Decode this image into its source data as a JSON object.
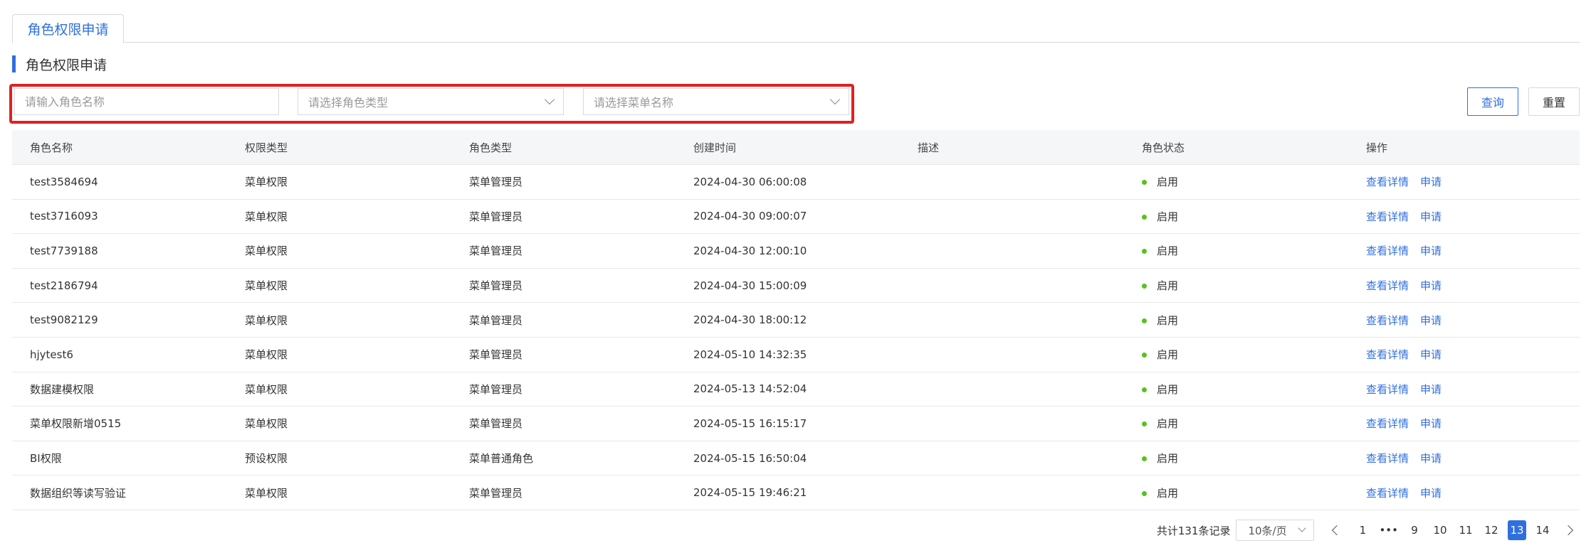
{
  "tabs": [
    {
      "label": "角色权限申请"
    }
  ],
  "section": {
    "title": "角色权限申请"
  },
  "filters": {
    "role_name_placeholder": "请输入角色名称",
    "role_type_placeholder": "请选择角色类型",
    "menu_name_placeholder": "请选择菜单名称"
  },
  "buttons": {
    "query": "查询",
    "reset": "重置"
  },
  "table": {
    "headers": [
      "角色名称",
      "权限类型",
      "角色类型",
      "创建时间",
      "描述",
      "角色状态",
      "操作"
    ],
    "rows": [
      {
        "name": "test3584694",
        "perm_type": "菜单权限",
        "role_type": "菜单管理员",
        "created": "2024-04-30 06:00:08",
        "desc": "",
        "status": "启用",
        "view": "查看详情",
        "apply": "申请"
      },
      {
        "name": "test3716093",
        "perm_type": "菜单权限",
        "role_type": "菜单管理员",
        "created": "2024-04-30 09:00:07",
        "desc": "",
        "status": "启用",
        "view": "查看详情",
        "apply": "申请"
      },
      {
        "name": "test7739188",
        "perm_type": "菜单权限",
        "role_type": "菜单管理员",
        "created": "2024-04-30 12:00:10",
        "desc": "",
        "status": "启用",
        "view": "查看详情",
        "apply": "申请"
      },
      {
        "name": "test2186794",
        "perm_type": "菜单权限",
        "role_type": "菜单管理员",
        "created": "2024-04-30 15:00:09",
        "desc": "",
        "status": "启用",
        "view": "查看详情",
        "apply": "申请"
      },
      {
        "name": "test9082129",
        "perm_type": "菜单权限",
        "role_type": "菜单管理员",
        "created": "2024-04-30 18:00:12",
        "desc": "",
        "status": "启用",
        "view": "查看详情",
        "apply": "申请"
      },
      {
        "name": "hjytest6",
        "perm_type": "菜单权限",
        "role_type": "菜单管理员",
        "created": "2024-05-10 14:32:35",
        "desc": "",
        "status": "启用",
        "view": "查看详情",
        "apply": "申请"
      },
      {
        "name": "数据建模权限",
        "perm_type": "菜单权限",
        "role_type": "菜单管理员",
        "created": "2024-05-13 14:52:04",
        "desc": "",
        "status": "启用",
        "view": "查看详情",
        "apply": "申请"
      },
      {
        "name": "菜单权限新增0515",
        "perm_type": "菜单权限",
        "role_type": "菜单管理员",
        "created": "2024-05-15 16:15:17",
        "desc": "",
        "status": "启用",
        "view": "查看详情",
        "apply": "申请"
      },
      {
        "name": "BI权限",
        "perm_type": "预设权限",
        "role_type": "菜单普通角色",
        "created": "2024-05-15 16:50:04",
        "desc": "",
        "status": "启用",
        "view": "查看详情",
        "apply": "申请"
      },
      {
        "name": "数据组织等读写验证",
        "perm_type": "菜单权限",
        "role_type": "菜单管理员",
        "created": "2024-05-15 19:46:21",
        "desc": "",
        "status": "启用",
        "view": "查看详情",
        "apply": "申请"
      }
    ]
  },
  "pagination": {
    "total_text": "共计131条记录",
    "page_size": "10条/页",
    "pages": [
      "1",
      "•••",
      "9",
      "10",
      "11",
      "12",
      "13",
      "14"
    ],
    "current": "13"
  },
  "colors": {
    "accent": "#2f6fdf",
    "status_on": "#52c41a",
    "highlight_frame": "#e02020"
  }
}
